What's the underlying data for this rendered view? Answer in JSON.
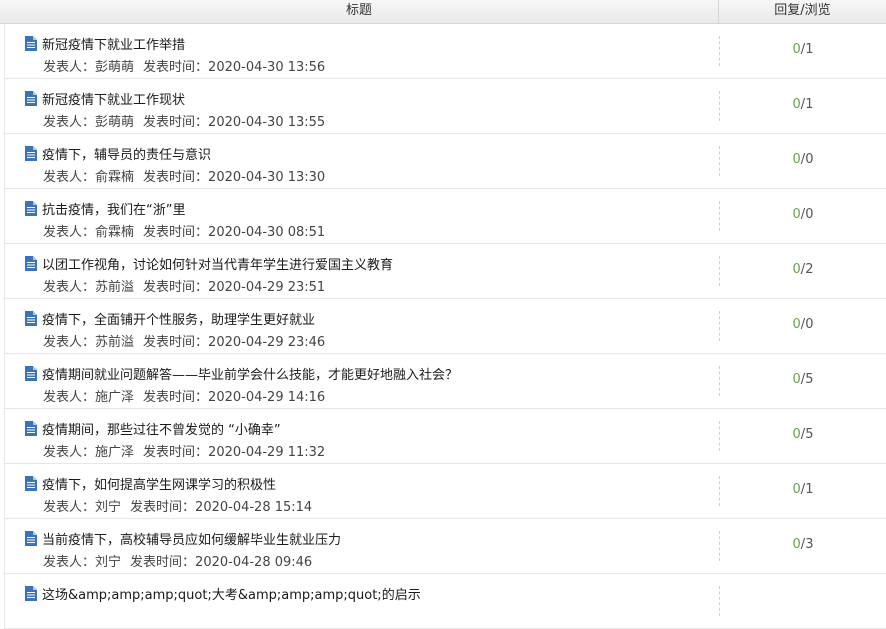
{
  "header": {
    "title_col": "标题",
    "stats_col": "回复/浏览"
  },
  "meta_labels": {
    "author": "发表人：",
    "time": "发表时间："
  },
  "rows": [
    {
      "title": "新冠疫情下就业工作举措",
      "author": "彭萌萌",
      "time": "2020-04-30 13:56",
      "replies": "0",
      "views": "1"
    },
    {
      "title": "新冠疫情下就业工作现状",
      "author": "彭萌萌",
      "time": "2020-04-30 13:55",
      "replies": "0",
      "views": "1"
    },
    {
      "title": "疫情下，辅导员的责任与意识",
      "author": "俞霖楠",
      "time": "2020-04-30 13:30",
      "replies": "0",
      "views": "0"
    },
    {
      "title": "抗击疫情，我们在“浙”里",
      "author": "俞霖楠",
      "time": "2020-04-30 08:51",
      "replies": "0",
      "views": "0"
    },
    {
      "title": "以团工作视角，讨论如何针对当代青年学生进行爱国主义教育",
      "author": "苏前溢",
      "time": "2020-04-29 23:51",
      "replies": "0",
      "views": "2"
    },
    {
      "title": "疫情下，全面铺开个性服务，助理学生更好就业",
      "author": "苏前溢",
      "time": "2020-04-29 23:46",
      "replies": "0",
      "views": "0"
    },
    {
      "title": "疫情期间就业问题解答——毕业前学会什么技能，才能更好地融入社会？",
      "author": "施广泽",
      "time": "2020-04-29 14:16",
      "replies": "0",
      "views": "5"
    },
    {
      "title": "疫情期间，那些过往不曾发觉的 “小确幸”",
      "author": "施广泽",
      "time": "2020-04-29 11:32",
      "replies": "0",
      "views": "5"
    },
    {
      "title": "疫情下，如何提高学生网课学习的积极性",
      "author": "刘宁",
      "time": "2020-04-28 15:14",
      "replies": "0",
      "views": "1"
    },
    {
      "title": "当前疫情下，高校辅导员应如何缓解毕业生就业压力",
      "author": "刘宁",
      "time": "2020-04-28 09:46",
      "replies": "0",
      "views": "3"
    },
    {
      "title": "这场&amp;amp;amp;quot;大考&amp;amp;amp;quot;的启示",
      "author": "",
      "time": "",
      "replies": "",
      "views": ""
    }
  ],
  "colors": {
    "reply": "#6aa04a",
    "icon": "#3b73b9"
  }
}
